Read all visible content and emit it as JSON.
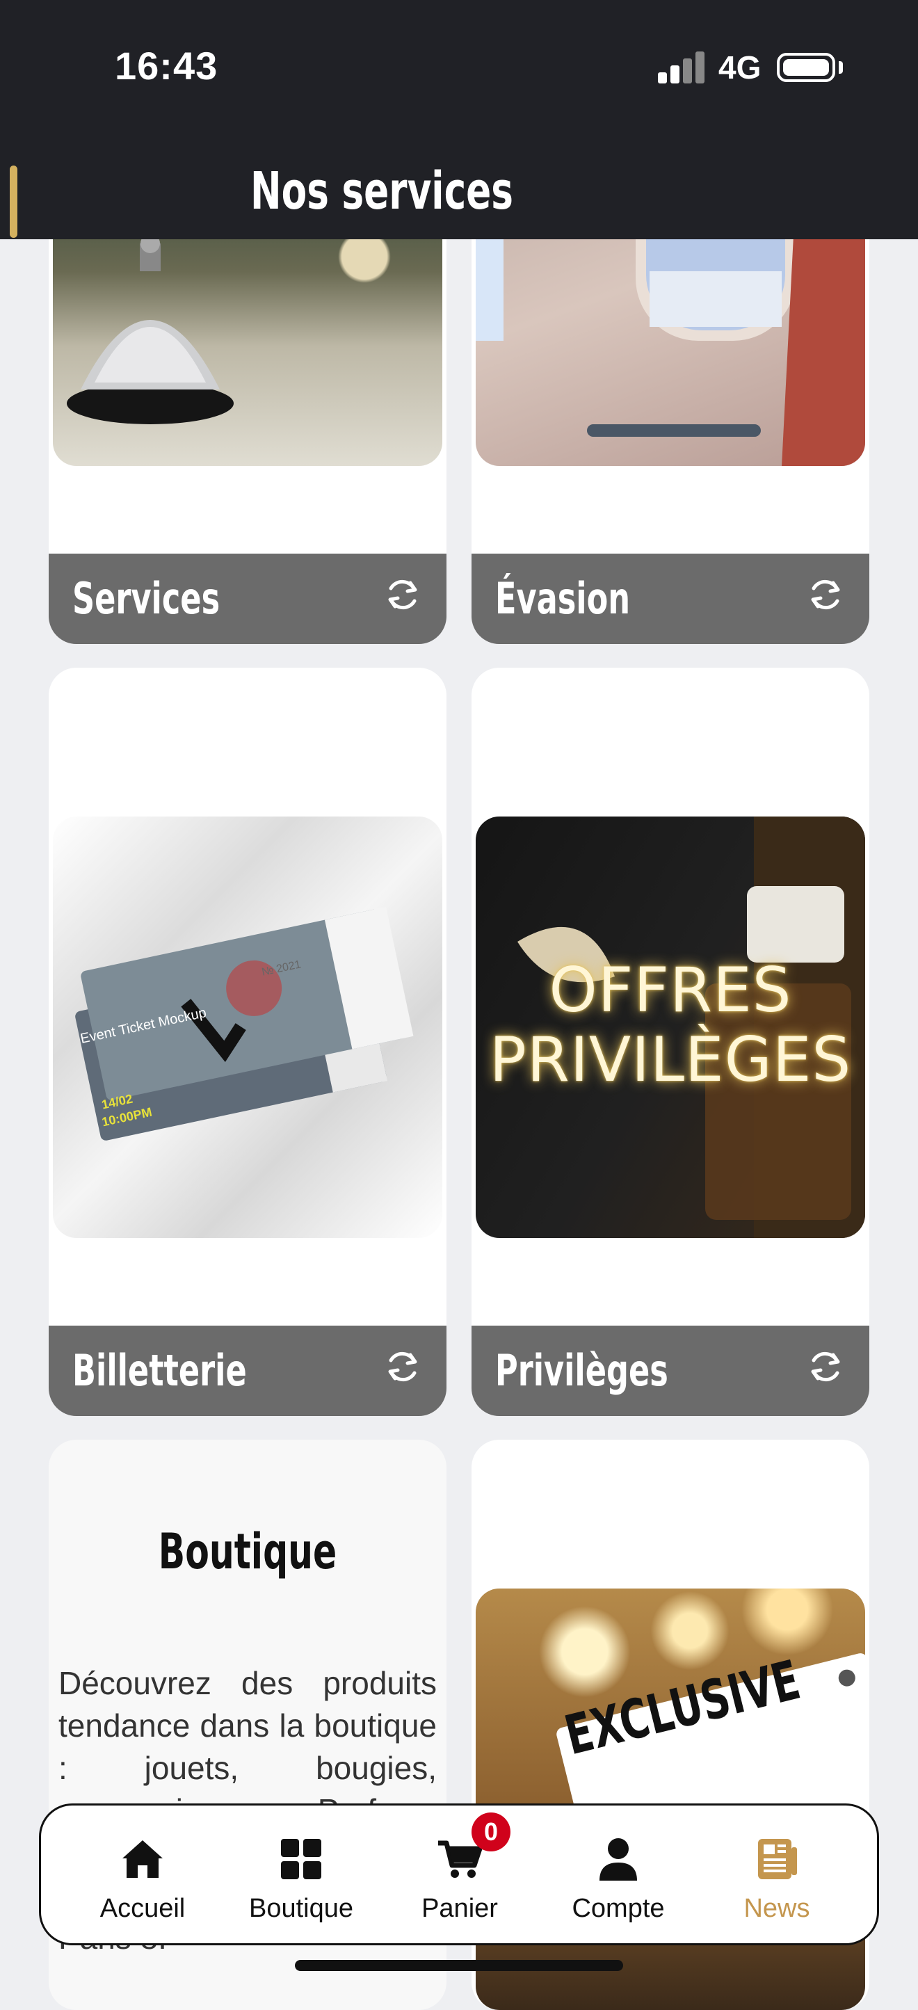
{
  "status_bar": {
    "time": "16:43",
    "network": "4G"
  },
  "header": {
    "title": "Nos services"
  },
  "cards": [
    {
      "label": "Services"
    },
    {
      "label": "Évasion"
    },
    {
      "label": "Billetterie"
    },
    {
      "label": "Privilèges"
    }
  ],
  "offers_image": {
    "line1": "OFFRES",
    "line2": "PRIVILÈGES"
  },
  "ticket_image": {
    "text1": "Event Ticket Mockup",
    "text2": "Event Ticket Mockup",
    "text3": "№ 2021",
    "date": "14/02",
    "time": "10:00PM"
  },
  "exclusive_image": {
    "text": "EXCLUSIVE"
  },
  "boutique": {
    "title": "Boutique",
    "text": "Découvrez des produits tendance dans la boutique : jouets, bougies, accessoires ou Parfums de Paris... Vous pouvez choisir avec la parfumerie Paris 8."
  },
  "bottom_nav": {
    "items": [
      {
        "label": "Accueil",
        "icon": "home-icon"
      },
      {
        "label": "Boutique",
        "icon": "grid-icon"
      },
      {
        "label": "Panier",
        "icon": "cart-icon"
      },
      {
        "label": "Compte",
        "icon": "user-icon"
      },
      {
        "label": "News",
        "icon": "newspaper-icon"
      }
    ],
    "cart_badge": "0",
    "active": "News"
  },
  "colors": {
    "accent": "#c4964e",
    "header_bg": "#202126",
    "badge": "#d0021b"
  }
}
